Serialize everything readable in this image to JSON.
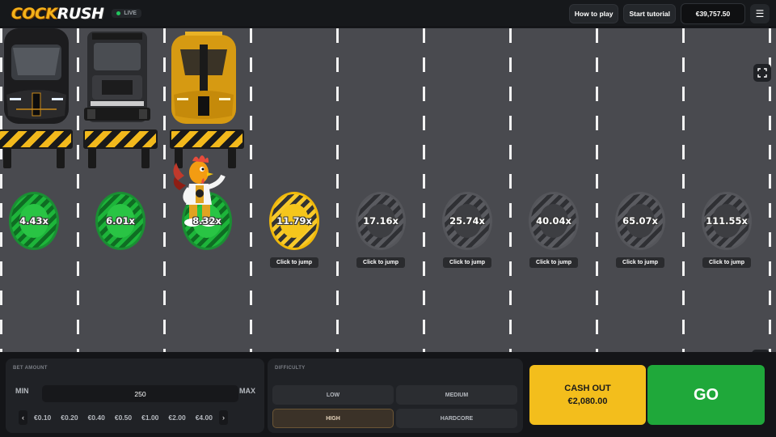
{
  "header": {
    "logo_part1": "COCK",
    "logo_part2": "RUSH",
    "live_label": "LIVE",
    "how_to_play": "How to play",
    "start_tutorial": "Start tutorial",
    "balance": "€39,757.50",
    "menu_icon": "hamburger-icon"
  },
  "colors": {
    "passed": "#1db53a",
    "current": "#f5c61c",
    "locked": "#3d3e42",
    "cashout": "#f3be1c",
    "go": "#1fa83a"
  },
  "lanes": [
    {
      "multiplier": "4.43x",
      "state": "passed",
      "car": "black-hypercar",
      "jump_label": ""
    },
    {
      "multiplier": "6.01x",
      "state": "passed",
      "car": "black-truck",
      "jump_label": ""
    },
    {
      "multiplier": "8.32x",
      "state": "passed",
      "car": "gold-hypercar",
      "jump_label": ""
    },
    {
      "multiplier": "11.79x",
      "state": "current",
      "car": "",
      "jump_label": "Click to jump"
    },
    {
      "multiplier": "17.16x",
      "state": "locked",
      "car": "",
      "jump_label": "Click to jump"
    },
    {
      "multiplier": "25.74x",
      "state": "locked",
      "car": "",
      "jump_label": "Click to jump"
    },
    {
      "multiplier": "40.04x",
      "state": "locked",
      "car": "",
      "jump_label": "Click to jump"
    },
    {
      "multiplier": "65.07x",
      "state": "locked",
      "car": "",
      "jump_label": "Click to jump"
    },
    {
      "multiplier": "111.55x",
      "state": "locked",
      "car": "",
      "jump_label": "Click to jump"
    }
  ],
  "bet": {
    "title": "BET AMOUNT",
    "min_label": "MIN",
    "max_label": "MAX",
    "value": "250",
    "prev": "‹",
    "next": "›",
    "chips": [
      "€0.10",
      "€0.20",
      "€0.40",
      "€0.50",
      "€1.00",
      "€2.00",
      "€4.00"
    ]
  },
  "difficulty": {
    "title": "DIFFICULTY",
    "options": [
      "LOW",
      "MEDIUM",
      "HIGH",
      "HARDCORE"
    ],
    "selected": "HIGH"
  },
  "actions": {
    "cashout_label": "CASH OUT",
    "cashout_amount": "€2,080.00",
    "go_label": "GO"
  }
}
